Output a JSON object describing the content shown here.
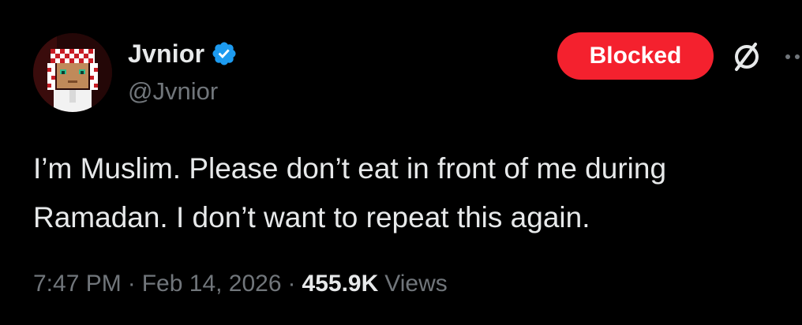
{
  "user": {
    "display_name": "Jvnior",
    "handle": "@Jvnior",
    "verified_icon": "verified-badge-icon",
    "avatar_icon": "pixel-avatar-icon"
  },
  "actions": {
    "blocked_label": "Blocked",
    "grok_icon": "grok-icon",
    "more_icon": "more-dots-icon"
  },
  "tweet": {
    "text": "I’m Muslim. Please don’t eat in front of me during\nRamadan. I don’t want to repeat this again."
  },
  "meta": {
    "time": "7:47 PM",
    "separator": "·",
    "date": "Feb 14, 2026",
    "views_count": "455.9K",
    "views_label": "Views"
  },
  "colors": {
    "background": "#000000",
    "text_primary": "#e7e9ea",
    "text_secondary": "#71767b",
    "blocked_red": "#f4212e",
    "verified_blue": "#1d9bf0"
  }
}
